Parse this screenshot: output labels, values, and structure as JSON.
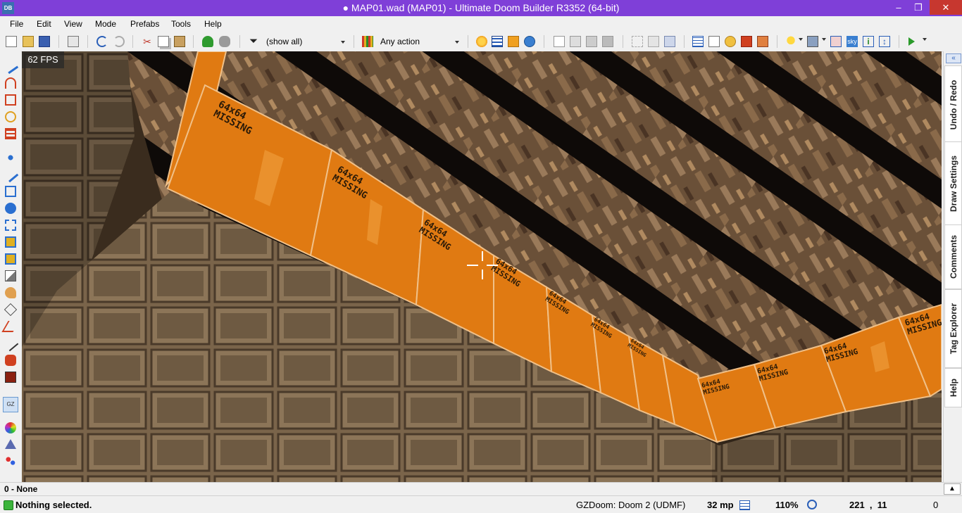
{
  "window": {
    "app_icon": "DB",
    "title": "● MAP01.wad (MAP01) - Ultimate Doom Builder R3352 (64-bit)",
    "minimize": "–",
    "maximize": "❐",
    "close": "✕",
    "accent": "#7f3fd8"
  },
  "menu": [
    "File",
    "Edit",
    "View",
    "Mode",
    "Prefabs",
    "Tools",
    "Help"
  ],
  "toolbar": {
    "filter_label": "(show all)",
    "action_label": "Any action",
    "sky_label": "sky"
  },
  "viewport": {
    "fps": "62 FPS",
    "missing_texture_text": [
      "64x64",
      "MISSING"
    ],
    "missing_color": "#e07a12"
  },
  "right_panel": {
    "tabs": [
      "Undo / Redo",
      "Draw Settings",
      "Comments",
      "Tag Explorer",
      "Help"
    ],
    "collapse_icon": "double-chevron-left-icon"
  },
  "info_bar": {
    "text": "0 - None"
  },
  "status": {
    "message": "Nothing selected.",
    "game_config": "GZDoom: Doom 2 (UDMF)",
    "grid": "32 mp",
    "zoom": "110%",
    "coordinates": "221  ,  11",
    "extra": "0"
  }
}
